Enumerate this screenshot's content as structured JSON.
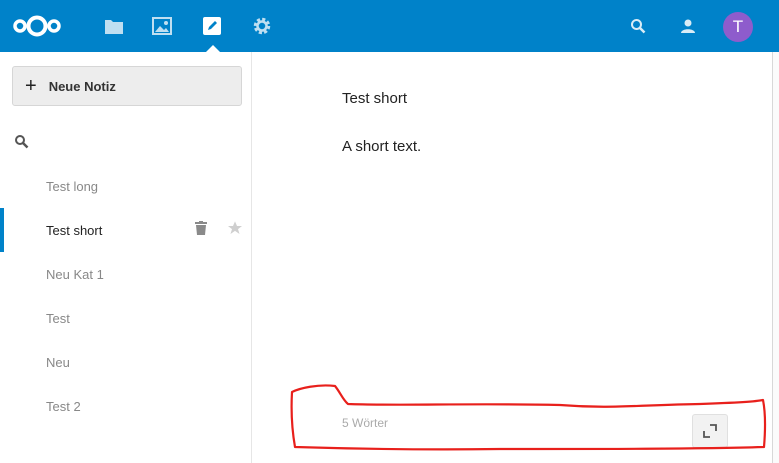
{
  "header": {
    "app_icons": [
      "files-icon",
      "gallery-icon",
      "notes-icon",
      "settings-icon"
    ],
    "avatar_initial": "T",
    "colors": {
      "bar": "#0082c9",
      "avatar": "#8e5ccc"
    }
  },
  "sidebar": {
    "new_note_label": "Neue Notiz",
    "notes": [
      {
        "title": "Test long",
        "active": false
      },
      {
        "title": "Test short",
        "active": true
      },
      {
        "title": "Neu Kat 1",
        "active": false
      },
      {
        "title": "Test",
        "active": false
      },
      {
        "title": "Neu",
        "active": false
      },
      {
        "title": "Test 2",
        "active": false
      }
    ]
  },
  "editor": {
    "title_line": "Test short",
    "body_line": "A short text.",
    "word_count": "5 Wörter"
  },
  "annotation": {
    "color": "#e8201c"
  }
}
